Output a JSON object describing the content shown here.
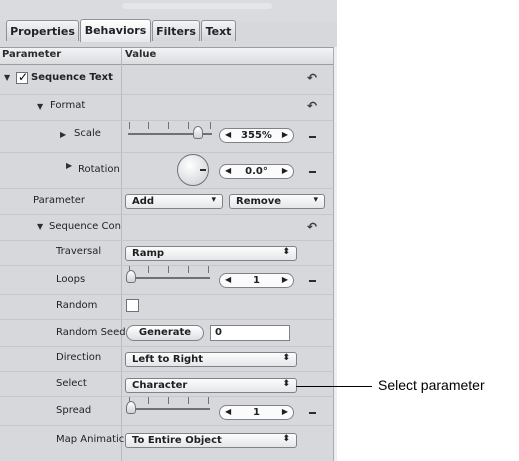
{
  "tabs": [
    {
      "label": "Properties"
    },
    {
      "label": "Behaviors"
    },
    {
      "label": "Filters"
    },
    {
      "label": "Text"
    }
  ],
  "active_tab": "Behaviors",
  "columns": {
    "parameter": "Parameter",
    "value": "Value"
  },
  "rows": {
    "sequence_text": {
      "label": "Sequence Text",
      "checked": true
    },
    "format": {
      "label": "Format"
    },
    "scale": {
      "label": "Scale",
      "value": "355%"
    },
    "rotation": {
      "label": "Rotation",
      "value": "0.0°"
    },
    "parameter": {
      "label": "Parameter",
      "add_label": "Add",
      "remove_label": "Remove"
    },
    "sequence_control": {
      "label": "Sequence Con"
    },
    "traversal": {
      "label": "Traversal",
      "value": "Ramp"
    },
    "loops": {
      "label": "Loops",
      "value": "1"
    },
    "random": {
      "label": "Random",
      "checked": false
    },
    "random_seed": {
      "label": "Random Seed",
      "button_label": "Generate",
      "value": "0"
    },
    "direction": {
      "label": "Direction",
      "value": "Left to Right"
    },
    "select": {
      "label": "Select",
      "value": "Character"
    },
    "spread": {
      "label": "Spread",
      "value": "1"
    },
    "map_animation": {
      "label": "Map Animatic",
      "value": "To Entire Object"
    }
  },
  "glyphs": {
    "triangle_down": "▼",
    "triangle_right": "▶",
    "reset": "↶",
    "arrow_left": "◀",
    "arrow_right": "▶",
    "popup_arrow": "▾",
    "updown_arrow": "⬍",
    "check": "✓"
  },
  "callout": {
    "text": "Select parameter"
  }
}
